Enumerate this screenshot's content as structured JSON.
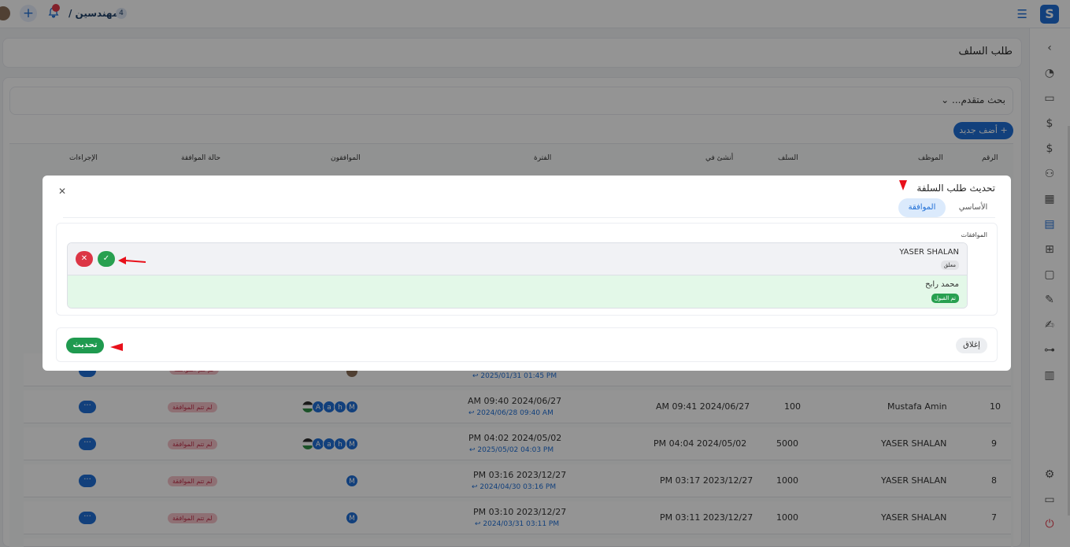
{
  "topbar": {
    "breadcrumb": "المهندسين /",
    "count": "4",
    "menu_icon": "☰",
    "logo": "S",
    "bell_icon": "🔔",
    "plus_icon": "+"
  },
  "page": {
    "title": "طلب السلف",
    "advanced_search": "بحث متقدم...",
    "add_button": "+ أضف جديد"
  },
  "table": {
    "headers": [
      "الرقم",
      "الموظف",
      "السلف",
      "أنشئ في",
      "الفترة",
      "الموافقون",
      "حالة الموافقة",
      "الإجراءات"
    ],
    "partial_row": {
      "period_sub": "↩ 2025/01/31 01:45 PM",
      "status": "لم تتم الموافقة"
    },
    "rows": [
      {
        "num": "10",
        "employee": "Mustafa Amin",
        "amount": "100",
        "created": "AM 09:41 2024/06/27",
        "period": "AM 09:40 2024/06/27",
        "period_sub": "↩ 2024/06/28 09:40 AM",
        "approvers": [
          "flag",
          "A",
          "a",
          "h",
          "M"
        ],
        "status": "لم تتم الموافقة",
        "actions": "···"
      },
      {
        "num": "9",
        "employee": "YASER SHALAN",
        "amount": "5000",
        "created": "PM 04:04 2024/05/02",
        "period": "PM 04:02 2024/05/02",
        "period_sub": "↩ 2025/05/02 04:03 PM",
        "approvers": [
          "flag",
          "A",
          "a",
          "h",
          "M"
        ],
        "status": "لم تتم الموافقة",
        "actions": "···"
      },
      {
        "num": "8",
        "employee": "YASER SHALAN",
        "amount": "1000",
        "created": "PM 03:17 2023/12/27",
        "period": "PM 03:16 2023/12/27",
        "period_sub": "↩ 2024/04/30 03:16 PM",
        "approvers": [
          "M"
        ],
        "status": "لم تتم الموافقة",
        "actions": "···"
      },
      {
        "num": "7",
        "employee": "YASER SHALAN",
        "amount": "1000",
        "created": "PM 03:11 2023/12/27",
        "period": "PM 03:10 2023/12/27",
        "period_sub": "↩ 2024/03/31 03:11 PM",
        "approvers": [
          "M"
        ],
        "status": "لم تتم الموافقة",
        "actions": "···"
      }
    ]
  },
  "modal": {
    "title": "تحديث طلب السلفة",
    "close_icon": "✕",
    "tabs": [
      {
        "label": "الأساسي",
        "active": false
      },
      {
        "label": "الموافقة",
        "active": true
      }
    ],
    "approvals_label": "الموافقات",
    "approvers": [
      {
        "name": "YASER SHALAN",
        "status": "معلق"
      },
      {
        "name": "محمد رابح",
        "status": "تم القبول"
      }
    ],
    "reject_icon": "✕",
    "accept_icon": "✓",
    "update_button": "تحديث",
    "close_button": "إغلاق"
  },
  "colors": {
    "primary": "#1f6fd6",
    "success": "#28a050",
    "danger": "#dc3545",
    "annotation": "#e8101a"
  }
}
